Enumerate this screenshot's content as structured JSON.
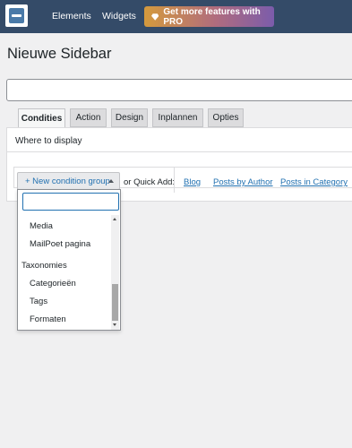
{
  "topbar": {
    "logo_icon": "sidebar-logo-icon",
    "nav": [
      "Elements",
      "Widgets"
    ],
    "pro_label": "Get more features with PRO",
    "pro_icon": "diamond-icon",
    "colors": {
      "bar": "#344b68",
      "pro_start": "#d49a3d",
      "pro_end": "#7b5cab"
    }
  },
  "page": {
    "title": "Nieuwe Sidebar",
    "name_value": ""
  },
  "tabs": [
    {
      "label": "Condities",
      "active": true
    },
    {
      "label": "Action",
      "active": false
    },
    {
      "label": "Design",
      "active": false
    },
    {
      "label": "Inplannen",
      "active": false
    },
    {
      "label": "Opties",
      "active": false
    }
  ],
  "panel": {
    "title": "Where to display",
    "new_condition_label": "+ New condition group",
    "quick_add_label": "or Quick Add:",
    "quick_links": [
      "Blog",
      "Posts by Author",
      "Posts in Category"
    ]
  },
  "dropdown": {
    "search_value": "",
    "items": [
      {
        "type": "option",
        "label": "Media"
      },
      {
        "type": "option",
        "label": "MailPoet pagina"
      },
      {
        "type": "group",
        "label": "Taxonomies"
      },
      {
        "type": "option",
        "label": "Categorieën"
      },
      {
        "type": "option",
        "label": "Tags"
      },
      {
        "type": "option",
        "label": "Formaten"
      }
    ],
    "scroll_position": 0.75
  },
  "accent_color": "#2271b1"
}
